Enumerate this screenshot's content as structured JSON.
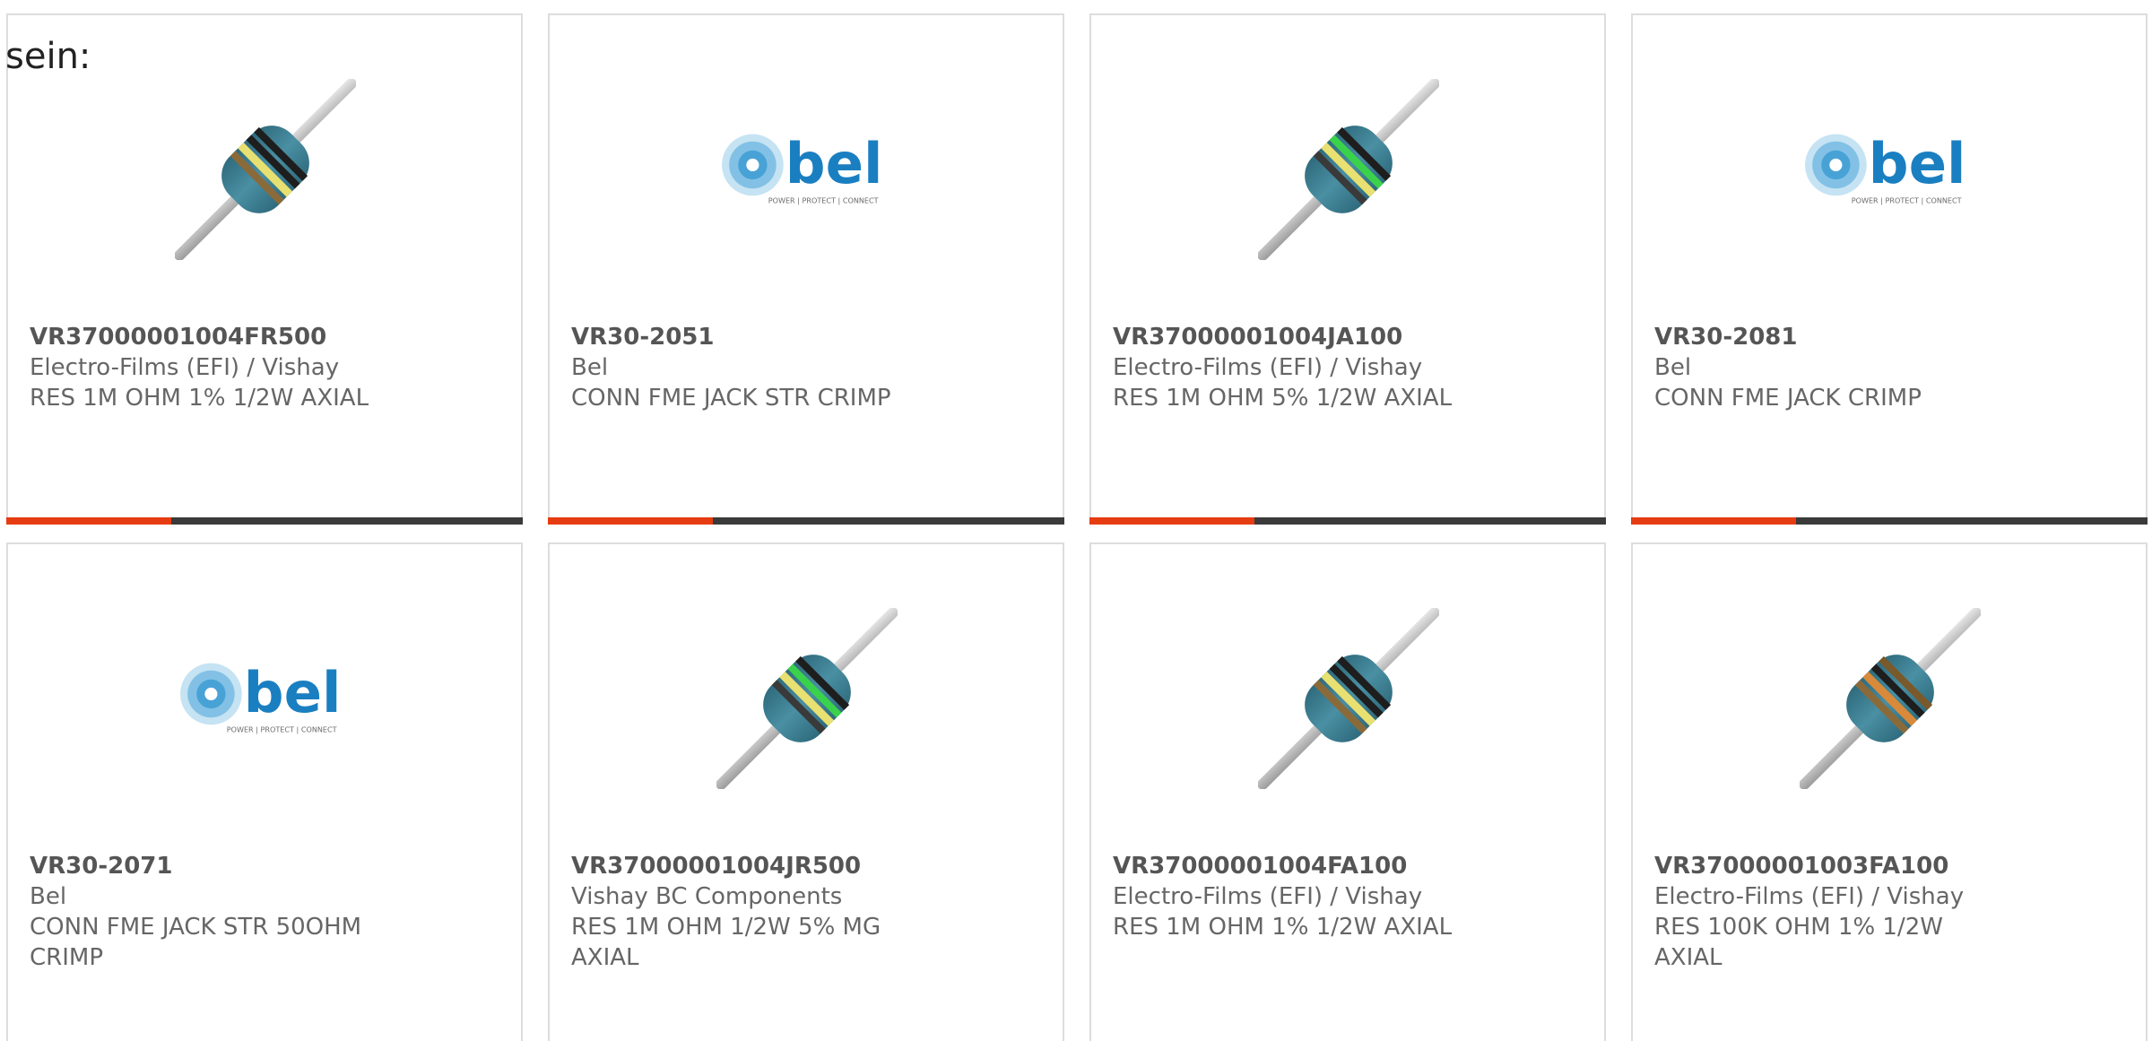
{
  "intro": {
    "text": "sein:"
  },
  "products": [
    {
      "part": "VR37000001004FR500",
      "manufacturer": "Electro-Films (EFI) / Vishay",
      "description": "RES 1M OHM 1% 1/2W AXIAL",
      "image": "resistor-yellow-bands"
    },
    {
      "part": "VR30-2051",
      "manufacturer": "Bel",
      "description": "CONN FME JACK STR CRIMP",
      "image": "bel-logo",
      "logo_tagline": "POWER | PROTECT | CONNECT"
    },
    {
      "part": "VR37000001004JA100",
      "manufacturer": "Electro-Films (EFI) / Vishay",
      "description": "RES 1M OHM 5% 1/2W AXIAL",
      "image": "resistor-green-bands"
    },
    {
      "part": "VR30-2081",
      "manufacturer": "Bel",
      "description": "CONN FME JACK CRIMP",
      "image": "bel-logo",
      "logo_tagline": "POWER | PROTECT | CONNECT"
    },
    {
      "part": "VR30-2071",
      "manufacturer": "Bel",
      "description": "CONN FME JACK STR 50OHM CRIMP",
      "image": "bel-logo",
      "logo_tagline": "POWER | PROTECT | CONNECT"
    },
    {
      "part": "VR37000001004JR500",
      "manufacturer": "Vishay BC Components",
      "description": "RES 1M OHM 1/2W 5% MG AXIAL",
      "image": "resistor-green-bands"
    },
    {
      "part": "VR37000001004FA100",
      "manufacturer": "Electro-Films (EFI) / Vishay",
      "description": "RES 1M OHM 1% 1/2W AXIAL",
      "image": "resistor-yellow-bands"
    },
    {
      "part": "VR37000001003FA100",
      "manufacturer": "Electro-Films (EFI) / Vishay",
      "description": "RES 100K OHM 1% 1/2W AXIAL",
      "image": "resistor-orange-bands"
    }
  ],
  "colors": {
    "accent": "#e63c12",
    "bar": "#3a3a3a",
    "bel_blue": "#1a7fc1",
    "resistor_body": "#3d7f93"
  }
}
